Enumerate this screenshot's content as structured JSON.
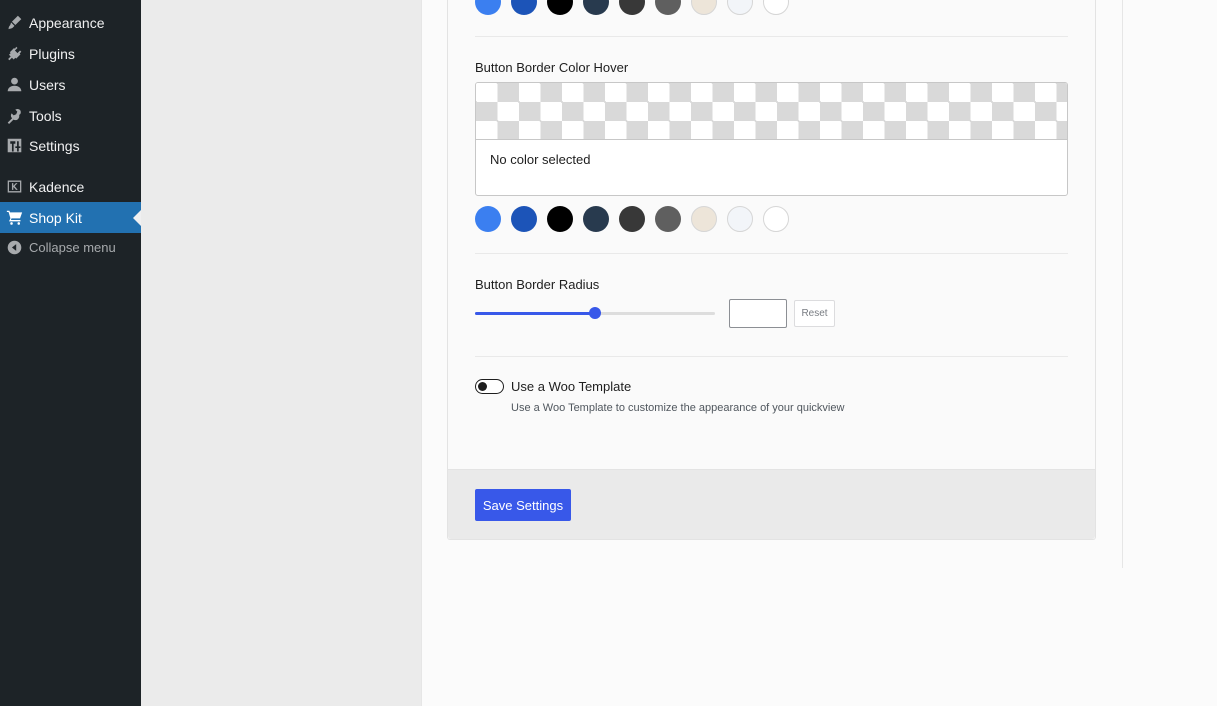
{
  "sidebar": {
    "items": [
      {
        "label": "Appearance",
        "icon": "paintbrush-icon"
      },
      {
        "label": "Plugins",
        "icon": "plug-icon"
      },
      {
        "label": "Users",
        "icon": "user-icon"
      },
      {
        "label": "Tools",
        "icon": "wrench-icon"
      },
      {
        "label": "Settings",
        "icon": "settings-icon"
      },
      {
        "label": "Kadence",
        "icon": "kadence-icon"
      },
      {
        "label": "Shop Kit",
        "icon": "cart-icon",
        "active": true
      },
      {
        "label": "Collapse menu",
        "icon": "collapse-icon"
      }
    ]
  },
  "settings": {
    "border_color_hover_label": "Button Border Color Hover",
    "no_color_text": "No color selected",
    "border_radius_label": "Button Border Radius",
    "border_radius_value": 0.5,
    "reset_label": "Reset",
    "woo_template_label": "Use a Woo Template",
    "woo_template_help": "Use a Woo Template to customize the appearance of your quickview",
    "woo_template_enabled": false,
    "save_label": "Save Settings"
  },
  "palette": [
    "#3b7ff0",
    "#1c54b8",
    "#000000",
    "#283a4e",
    "#383838",
    "#5f5f5f",
    "#ede5d9",
    "#f2f5f9",
    "#ffffff"
  ],
  "colors": {
    "accent": "#3858e9",
    "sidebar_bg": "#1d2327",
    "sidebar_active": "#2271b1"
  }
}
